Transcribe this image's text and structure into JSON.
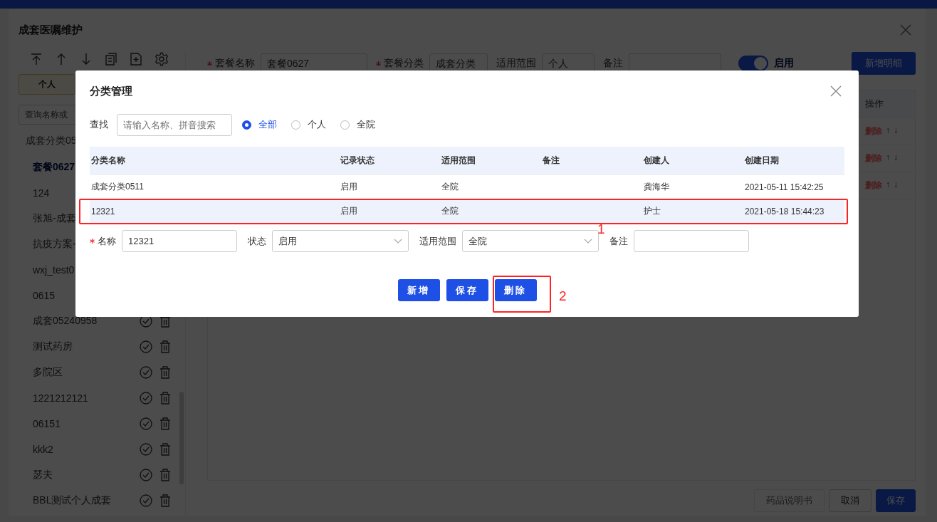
{
  "app_dialog": {
    "title": "成套医嘱维护",
    "left_panel": {
      "scope_tabs": [
        {
          "label": "个人",
          "selected": true
        }
      ],
      "search": {
        "placeholder": "查询名称或"
      },
      "items": [
        {
          "label": "成套分类05",
          "kind": "group",
          "selected": false
        },
        {
          "label": "套餐0627",
          "kind": "item",
          "selected": true
        },
        {
          "label": "124",
          "kind": "item",
          "selected": false
        },
        {
          "label": "张旭-成套",
          "kind": "item",
          "selected": false
        },
        {
          "label": "抗疫方案-",
          "kind": "item",
          "selected": false
        },
        {
          "label": "wxj_test0",
          "kind": "item",
          "selected": false
        },
        {
          "label": "0615",
          "kind": "item",
          "selected": false
        },
        {
          "label": "成套05240958",
          "kind": "item_with_actions",
          "selected": false
        },
        {
          "label": "测试药房",
          "kind": "item_with_actions",
          "selected": false
        },
        {
          "label": "多院区",
          "kind": "item_with_actions",
          "selected": false
        },
        {
          "label": "1221212121",
          "kind": "item_with_actions",
          "selected": false
        },
        {
          "label": "06151",
          "kind": "item_with_actions",
          "selected": false
        },
        {
          "label": "kkk2",
          "kind": "item_with_actions",
          "selected": false
        },
        {
          "label": "瑟夫",
          "kind": "item_with_actions",
          "selected": false
        },
        {
          "label": "BBL测试个人成套",
          "kind": "item_with_actions",
          "selected": false
        }
      ]
    },
    "form": {
      "package_name": {
        "label": "套餐名称",
        "required": true,
        "value": "套餐0627"
      },
      "category": {
        "label": "套餐分类",
        "required": true,
        "value": "成套分类"
      },
      "scope": {
        "label": "适用范围",
        "value": "个人"
      },
      "note": {
        "label": "备注"
      },
      "enabled": {
        "label": "启用",
        "on": true
      },
      "add_detail_button": "新增明细"
    },
    "table": {
      "columns": [
        "操作"
      ],
      "rows": [
        {
          "delete": "删除",
          "up": "↑",
          "down": "↓"
        },
        {
          "delete": "删除",
          "up": "↑",
          "down": "↓"
        },
        {
          "delete": "删除",
          "up": "↑",
          "down": "↓"
        }
      ]
    },
    "footer_buttons": [
      {
        "label": "药品说明书",
        "kind": "default",
        "disabled": true
      },
      {
        "label": "取消",
        "kind": "default",
        "disabled": false
      },
      {
        "label": "保存",
        "kind": "primary",
        "disabled": false
      }
    ]
  },
  "modal": {
    "title": "分类管理",
    "search": {
      "label": "查找",
      "placeholder": "请输入名称、拼音搜索"
    },
    "filters": [
      {
        "label": "全部",
        "selected": true
      },
      {
        "label": "个人",
        "selected": false
      },
      {
        "label": "全院",
        "selected": false
      }
    ],
    "table": {
      "columns": [
        "分类名称",
        "记录状态",
        "适用范围",
        "备注",
        "创建人",
        "创建日期"
      ],
      "rows": [
        {
          "name": "成套分类0511",
          "status": "启用",
          "scope": "全院",
          "creator": "龚海华",
          "created": "2021-05-11 15:42:25",
          "selected": false
        },
        {
          "name": "12321",
          "status": "启用",
          "scope": "全院",
          "creator": "护士",
          "created": "2021-05-18 15:44:23",
          "selected": true
        }
      ]
    },
    "edit_form": {
      "name": {
        "label": "名称",
        "required": true,
        "value": "12321"
      },
      "status": {
        "label": "状态",
        "value": "启用"
      },
      "scope": {
        "label": "适用范围",
        "value": "全院"
      },
      "note": {
        "label": "备注"
      }
    },
    "buttons": [
      "新增",
      "保存",
      "删除"
    ],
    "annotations": [
      {
        "label": "1"
      },
      {
        "label": "2"
      }
    ]
  }
}
